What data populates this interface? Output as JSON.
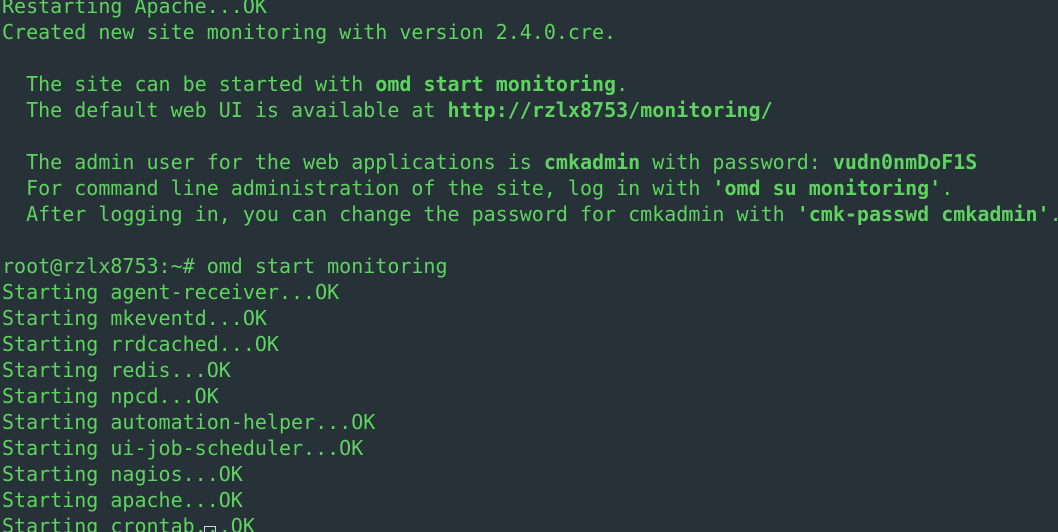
{
  "terminal": {
    "colors": {
      "background": "#263238",
      "text": "#5fd35f"
    },
    "lines": [
      {
        "type": "text",
        "text": "Restarting Apache...OK"
      },
      {
        "type": "text",
        "text": "Created new site monitoring with version 2.4.0.cre."
      },
      {
        "type": "blank"
      },
      {
        "type": "seg",
        "segments": [
          {
            "t": "  The site can be started with ",
            "b": false
          },
          {
            "t": "omd start monitoring",
            "b": true
          },
          {
            "t": ".",
            "b": false
          }
        ]
      },
      {
        "type": "seg",
        "segments": [
          {
            "t": "  The default web UI is available at ",
            "b": false
          },
          {
            "t": "http://rzlx8753/monitoring/",
            "b": true
          }
        ]
      },
      {
        "type": "blank"
      },
      {
        "type": "seg",
        "segments": [
          {
            "t": "  The admin user for the web applications is ",
            "b": false
          },
          {
            "t": "cmkadmin",
            "b": true
          },
          {
            "t": " with password: ",
            "b": false
          },
          {
            "t": "vudn0nmDoF1S",
            "b": true
          }
        ]
      },
      {
        "type": "seg",
        "segments": [
          {
            "t": "  For command line administration of the site, log in with ",
            "b": false
          },
          {
            "t": "'omd su monitoring'",
            "b": true
          },
          {
            "t": ".",
            "b": false
          }
        ]
      },
      {
        "type": "seg",
        "segments": [
          {
            "t": "  After logging in, you can change the password for cmkadmin with ",
            "b": false
          },
          {
            "t": "'cmk-passwd cmkadmin'",
            "b": true
          },
          {
            "t": ".",
            "b": false
          }
        ]
      },
      {
        "type": "blank"
      },
      {
        "type": "text",
        "text": "root@rzlx8753:~# omd start monitoring"
      },
      {
        "type": "text",
        "text": "Starting agent-receiver...OK"
      },
      {
        "type": "text",
        "text": "Starting mkeventd...OK"
      },
      {
        "type": "text",
        "text": "Starting rrdcached...OK"
      },
      {
        "type": "text",
        "text": "Starting redis...OK"
      },
      {
        "type": "text",
        "text": "Starting npcd...OK"
      },
      {
        "type": "text",
        "text": "Starting automation-helper...OK"
      },
      {
        "type": "text",
        "text": "Starting ui-job-scheduler...OK"
      },
      {
        "type": "text",
        "text": "Starting nagios...OK"
      },
      {
        "type": "text",
        "text": "Starting apache...OK"
      },
      {
        "type": "text",
        "text": "Starting crontab...OK"
      }
    ]
  }
}
